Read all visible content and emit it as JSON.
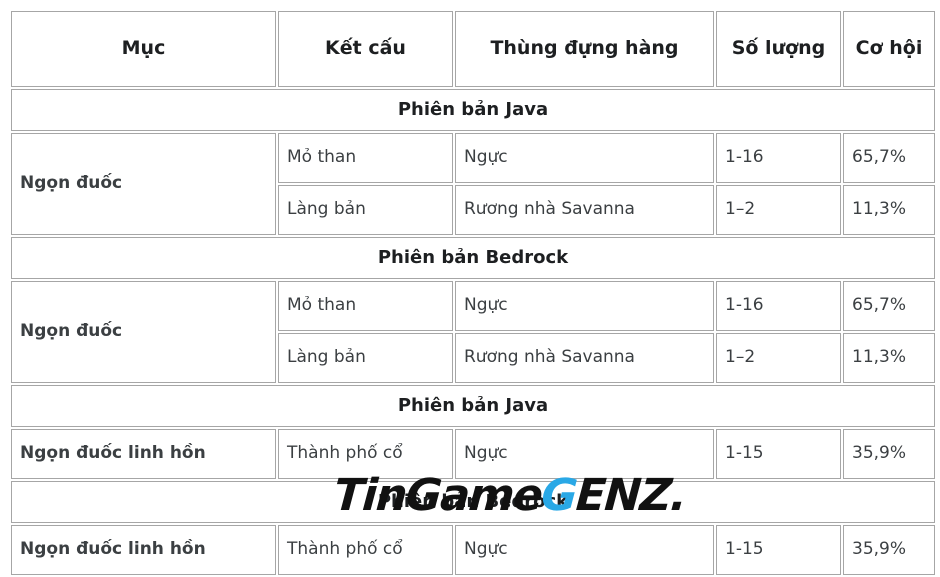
{
  "table": {
    "columns": [
      {
        "label": "Mục"
      },
      {
        "label": "Kết cấu"
      },
      {
        "label": "Thùng đựng hàng"
      },
      {
        "label": "Số lượng"
      },
      {
        "label": "Cơ hội"
      }
    ],
    "sections": [
      {
        "title": "Phiên bản Java",
        "rows": [
          {
            "item": "Ngọn đuốc",
            "structure": "Mỏ than",
            "container": "Ngực",
            "amount": "1-16",
            "chance": "65,7%"
          },
          {
            "item": "",
            "structure": "Làng bản",
            "container": "Rương nhà Savanna",
            "amount": "1–2",
            "chance": "11,3%"
          }
        ]
      },
      {
        "title": "Phiên bản Bedrock",
        "rows": [
          {
            "item": "Ngọn đuốc",
            "structure": "Mỏ than",
            "container": "Ngực",
            "amount": "1-16",
            "chance": "65,7%"
          },
          {
            "item": "",
            "structure": "Làng bản",
            "container": "Rương nhà Savanna",
            "amount": "1–2",
            "chance": "11,3%"
          }
        ]
      },
      {
        "title": "Phiên bản Java",
        "rows": [
          {
            "item": "Ngọn đuốc linh hồn",
            "structure": "Thành phố cổ",
            "container": "Ngực",
            "amount": "1-15",
            "chance": "35,9%"
          }
        ]
      },
      {
        "title": "Phiên bản Bedrock",
        "rows": [
          {
            "item": "Ngọn đuốc linh hồn",
            "structure": "Thành phố cổ",
            "container": "Ngực",
            "amount": "1-15",
            "chance": "35,9%"
          }
        ]
      }
    ]
  },
  "watermark": {
    "part1": "TinGame",
    "part2": "G",
    "part3": "ENZ.",
    "blue": "#29a8e6",
    "dark": "#111111"
  }
}
